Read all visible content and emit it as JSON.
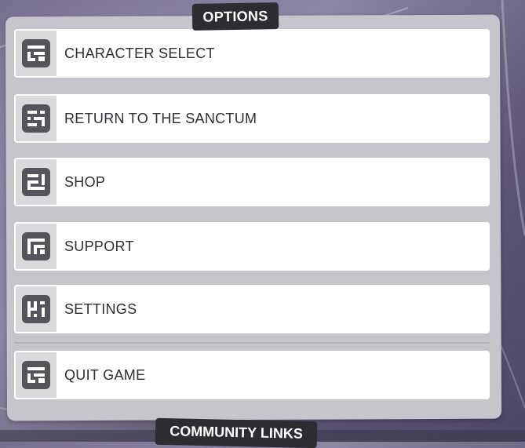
{
  "options_title": "OPTIONS",
  "menu": [
    {
      "label": "CHARACTER SELECT",
      "icon": "character-select-icon"
    },
    {
      "label": "RETURN TO THE SANCTUM",
      "icon": "sanctum-icon"
    },
    {
      "label": "SHOP",
      "icon": "shop-icon"
    },
    {
      "label": "SUPPORT",
      "icon": "support-icon"
    },
    {
      "label": "SETTINGS",
      "icon": "settings-icon"
    },
    {
      "label": "QUIT GAME",
      "icon": "quit-game-icon"
    }
  ],
  "community_title": "COMMUNITY LINKS",
  "colors": {
    "panel": "#c7c5cc",
    "row": "#ffffff",
    "title_bg": "#2d2c31",
    "icon_fill": "#55545b"
  }
}
